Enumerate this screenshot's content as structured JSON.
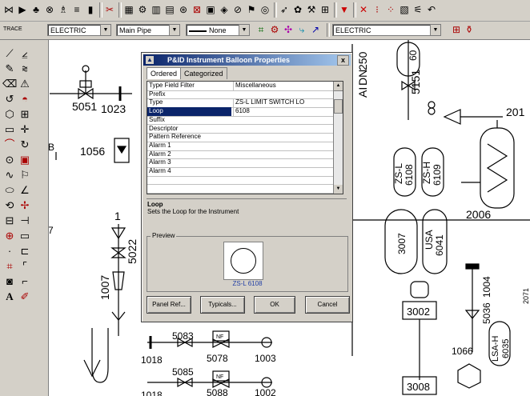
{
  "toolbar2": {
    "trace_label": "TRACE",
    "layer_combo": "ELECTRIC",
    "pipe_combo": "Main Pipe",
    "line_combo": "None",
    "layer_combo2": "ELECTRIC"
  },
  "dialog": {
    "title": "P&ID Instrument Balloon Properties",
    "close_label": "x",
    "tabs": [
      "Ordered",
      "Categorized"
    ],
    "rows": [
      {
        "name": "Type Field Filter",
        "value": "Miscellaneous"
      },
      {
        "name": "Prefix",
        "value": ""
      },
      {
        "name": "Type",
        "value": "ZS-L        LIMIT SWITCH LO"
      },
      {
        "name": "Loop",
        "value": "6108"
      },
      {
        "name": "Suffix",
        "value": ""
      },
      {
        "name": "Descriptor",
        "value": ""
      },
      {
        "name": "Pattern Reference",
        "value": ""
      },
      {
        "name": "Alarm 1",
        "value": ""
      },
      {
        "name": "Alarm 2",
        "value": ""
      },
      {
        "name": "Alarm 3",
        "value": ""
      },
      {
        "name": "Alarm 4",
        "value": ""
      },
      {
        "name": "",
        "value": ""
      },
      {
        "name": "",
        "value": ""
      }
    ],
    "desc_title": "Loop",
    "desc_text": "Sets the Loop for the Instrument",
    "preview_label": "Preview",
    "preview_tag": "ZS-L  6108",
    "buttons": {
      "panel_ref": "Panel Ref...",
      "typicals": "Typicals...",
      "ok": "OK",
      "cancel": "Cancel"
    }
  },
  "drawing": {
    "tags": {
      "t5051": "5051",
      "t1023": "1023",
      "t1056": "1056",
      "t1": "1",
      "t5022": "5022",
      "t1007": "1007",
      "t5083": "5083",
      "t5078": "5078",
      "t1003": "1003",
      "t1018": "1018",
      "t5085": "5085",
      "t5088": "5088",
      "t1002": "1002",
      "t1018b": "1018",
      "nf1": "NF",
      "nf2": "NF",
      "t250": "250",
      "tDN": "DN",
      "tAI": "AI",
      "t5151": "5151",
      "t60": "60",
      "zsl_a": "ZS-L",
      "zsl_b": "6108",
      "zsh_a": "ZS-H",
      "zsh_b": "6109",
      "t2006": "2006",
      "t201": "201",
      "t3007": "3007",
      "usa_a": "USA",
      "usa_b": "6041",
      "t3002": "3002",
      "t3008": "3008",
      "t1066": "1066",
      "t1004": "1004",
      "t5036": "5036",
      "lsh_a": "LSA-H",
      "lsh_b": "6035",
      "tB": "B",
      "t7": "7",
      "t2071": "2071"
    }
  },
  "colors": {
    "accent": "#0a246a",
    "title_end": "#a6caf0",
    "selection": "#0a246a",
    "preview_tag": "#223fa6"
  }
}
